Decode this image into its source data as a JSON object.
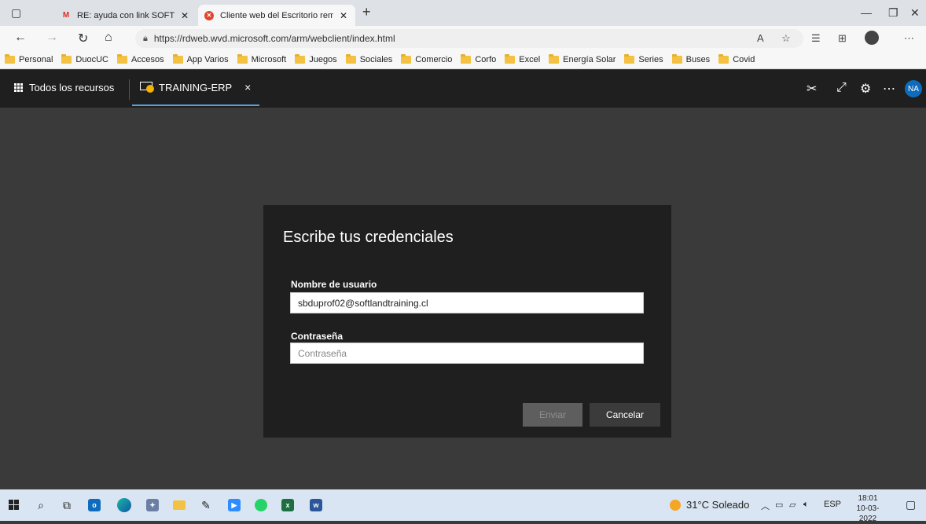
{
  "browser": {
    "tabs": [
      {
        "label": "RE: ayuda con link SOFTLAND - c",
        "icon": "gmail-icon",
        "active": false
      },
      {
        "label": "Cliente web del Escritorio remoto",
        "icon": "remote-desktop-icon",
        "active": true
      }
    ],
    "new_tab": "+",
    "url": "https://rdweb.wvd.microsoft.com/arm/webclient/index.html",
    "bookmarks": [
      "Personal",
      "DuocUC",
      "Accesos",
      "App Varios",
      "Microsoft",
      "Juegos",
      "Sociales",
      "Comercio",
      "Corfo",
      "Excel",
      "Energía Solar",
      "Series",
      "Buses",
      "Covid"
    ]
  },
  "rd": {
    "all_resources": "Todos los recursos",
    "session_tab": "TRAINING-ERP",
    "close": "×",
    "avatar": "NA"
  },
  "dialog": {
    "title": "Escribe tus credenciales",
    "username_label": "Nombre de usuario",
    "username_value": "sbduprof02@softlandtraining.cl",
    "password_label": "Contraseña",
    "password_placeholder": "Contraseña",
    "submit": "Enviar",
    "cancel": "Cancelar"
  },
  "taskbar": {
    "weather": "31°C Soleado",
    "language": "ESP",
    "time": "18:01",
    "date": "10-03-2022"
  },
  "colors": {
    "accent": "#4fa3e0",
    "dialog_bg": "#1f1f1f",
    "page_bg": "#3a3a3a",
    "header_bg": "#201f1f"
  }
}
